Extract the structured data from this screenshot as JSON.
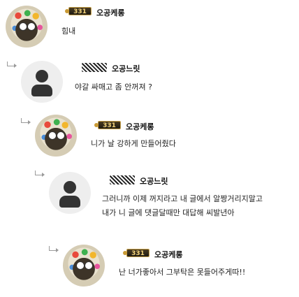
{
  "comments": [
    {
      "nickname": "오공케롱",
      "level": "331",
      "text": "힘내"
    },
    {
      "nickname": "오공느릿",
      "text": "야갈 싸매고 좀 안꺼져 ?"
    },
    {
      "nickname": "오공케롱",
      "level": "331",
      "text": "니가 날 강하게 만들어줬다"
    },
    {
      "nickname": "오공느릿",
      "text_lines": [
        "그러니까 이제 꺼지라고 내 글에서 알짱거리지말고",
        "내가 니 글에 댓글달때만 대답해 씨발년아"
      ]
    },
    {
      "nickname": "오공케롱",
      "level": "331",
      "text": "난 너가좋아서 그부탁은 못들어주게따!!"
    }
  ]
}
